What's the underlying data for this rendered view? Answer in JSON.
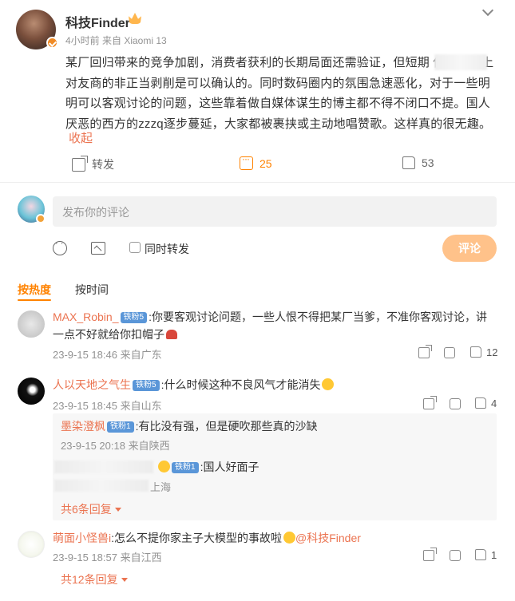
{
  "post": {
    "author": "科技Finder",
    "meta": "4小时前  来自 Xiaomi 13",
    "text": "某厂回归带来的竞争加剧，消费者获利的长期局面还需验证，但短期                  传播资产上对友商的非正当剥削是可以确认的。同时数码圈内的氛围急速恶化，对于一些明明可以客观讨论的问题，这些靠着做自媒体谋生的博主都不得不闭口不提。国人厌恶的西方的zzzq逐步蔓延，大家都被裹挟或主动地唱赞歌。这样真的很无趣。",
    "fold": "收起",
    "actions": {
      "share": "转发",
      "comments": "25",
      "likes": "53"
    }
  },
  "composer": {
    "placeholder": "发布你的评论",
    "repost_label": "同时转发",
    "submit": "评论"
  },
  "sort": {
    "hot": "按热度",
    "time": "按时间"
  },
  "comments": [
    {
      "name": "MAX_Robin_",
      "badge": "铁粉5",
      "text": ":你要客观讨论问题，一些人恨不得把某厂当爹，不准你客观讨论，讲一点不好就给你扣帽子",
      "meta": "23-9-15 18:46 来自广东",
      "likes": "12"
    },
    {
      "name": "人以天地之气生",
      "badge": "铁粉5",
      "text": ":什么时候这种不良风气才能消失",
      "meta": "23-9-15 18:45 来自山东",
      "likes": "4",
      "replies": [
        {
          "name": "墨染澄枫",
          "badge": "铁粉1",
          "text": ":有比没有强，但是硬吹那些真的沙缺",
          "meta": "23-9-15 20:18 来自陕西"
        },
        {
          "name": "",
          "badge": "铁粉1",
          "text": ":国人好面子",
          "meta": "上海"
        }
      ],
      "more": "共6条回复"
    },
    {
      "name": "萌面小怪兽i",
      "text": ":怎么不提你家主子大模型的事故啦",
      "mention": "@科技Finder",
      "meta": "23-9-15 18:57 来自江西",
      "likes": "1",
      "more": "共12条回复"
    }
  ],
  "colors": {
    "accent": "#ff8200",
    "link": "#eb7350",
    "fan_badge": "#5a96d8"
  }
}
